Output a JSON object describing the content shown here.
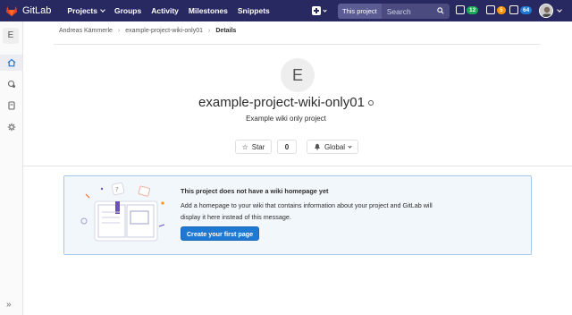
{
  "topbar": {
    "brand": "GitLab",
    "nav": [
      {
        "label": "Projects",
        "dropdown": true
      },
      {
        "label": "Groups",
        "dropdown": false
      },
      {
        "label": "Activity",
        "dropdown": false
      },
      {
        "label": "Milestones",
        "dropdown": false
      },
      {
        "label": "Snippets",
        "dropdown": false
      }
    ],
    "search": {
      "scope": "This project",
      "placeholder": "Search"
    },
    "counters": [
      {
        "icon": "issues-icon",
        "count": "12",
        "color": "#1aaa55"
      },
      {
        "icon": "merge-request-icon",
        "count": "5",
        "color": "#fc9403"
      },
      {
        "icon": "todo-icon",
        "count": "64",
        "color": "#1f78d1"
      }
    ]
  },
  "sidebar": {
    "project_initial": "E",
    "items": [
      {
        "icon": "home-icon",
        "active": true
      },
      {
        "icon": "issues-icon",
        "active": false
      },
      {
        "icon": "wiki-icon",
        "active": false
      },
      {
        "icon": "settings-icon",
        "active": false
      }
    ],
    "collapse": "»"
  },
  "breadcrumbs": [
    "Andreas Kämmerle",
    "example-project-wiki-only01",
    "Details"
  ],
  "project": {
    "initial": "E",
    "name": "example-project-wiki-only01",
    "description": "Example wiki only project",
    "star_label": "Star",
    "star_count": "0",
    "notification_label": "Global"
  },
  "empty_state": {
    "title": "This project does not have a wiki homepage yet",
    "body": "Add a homepage to your wiki that contains information about your project and GitLab will display it here instead of this message.",
    "button": "Create your first page"
  },
  "colors": {
    "nav_bg": "#292961",
    "primary": "#1f78d1",
    "panel_bg": "#f2f7fc",
    "panel_border": "#a8c8e8"
  }
}
